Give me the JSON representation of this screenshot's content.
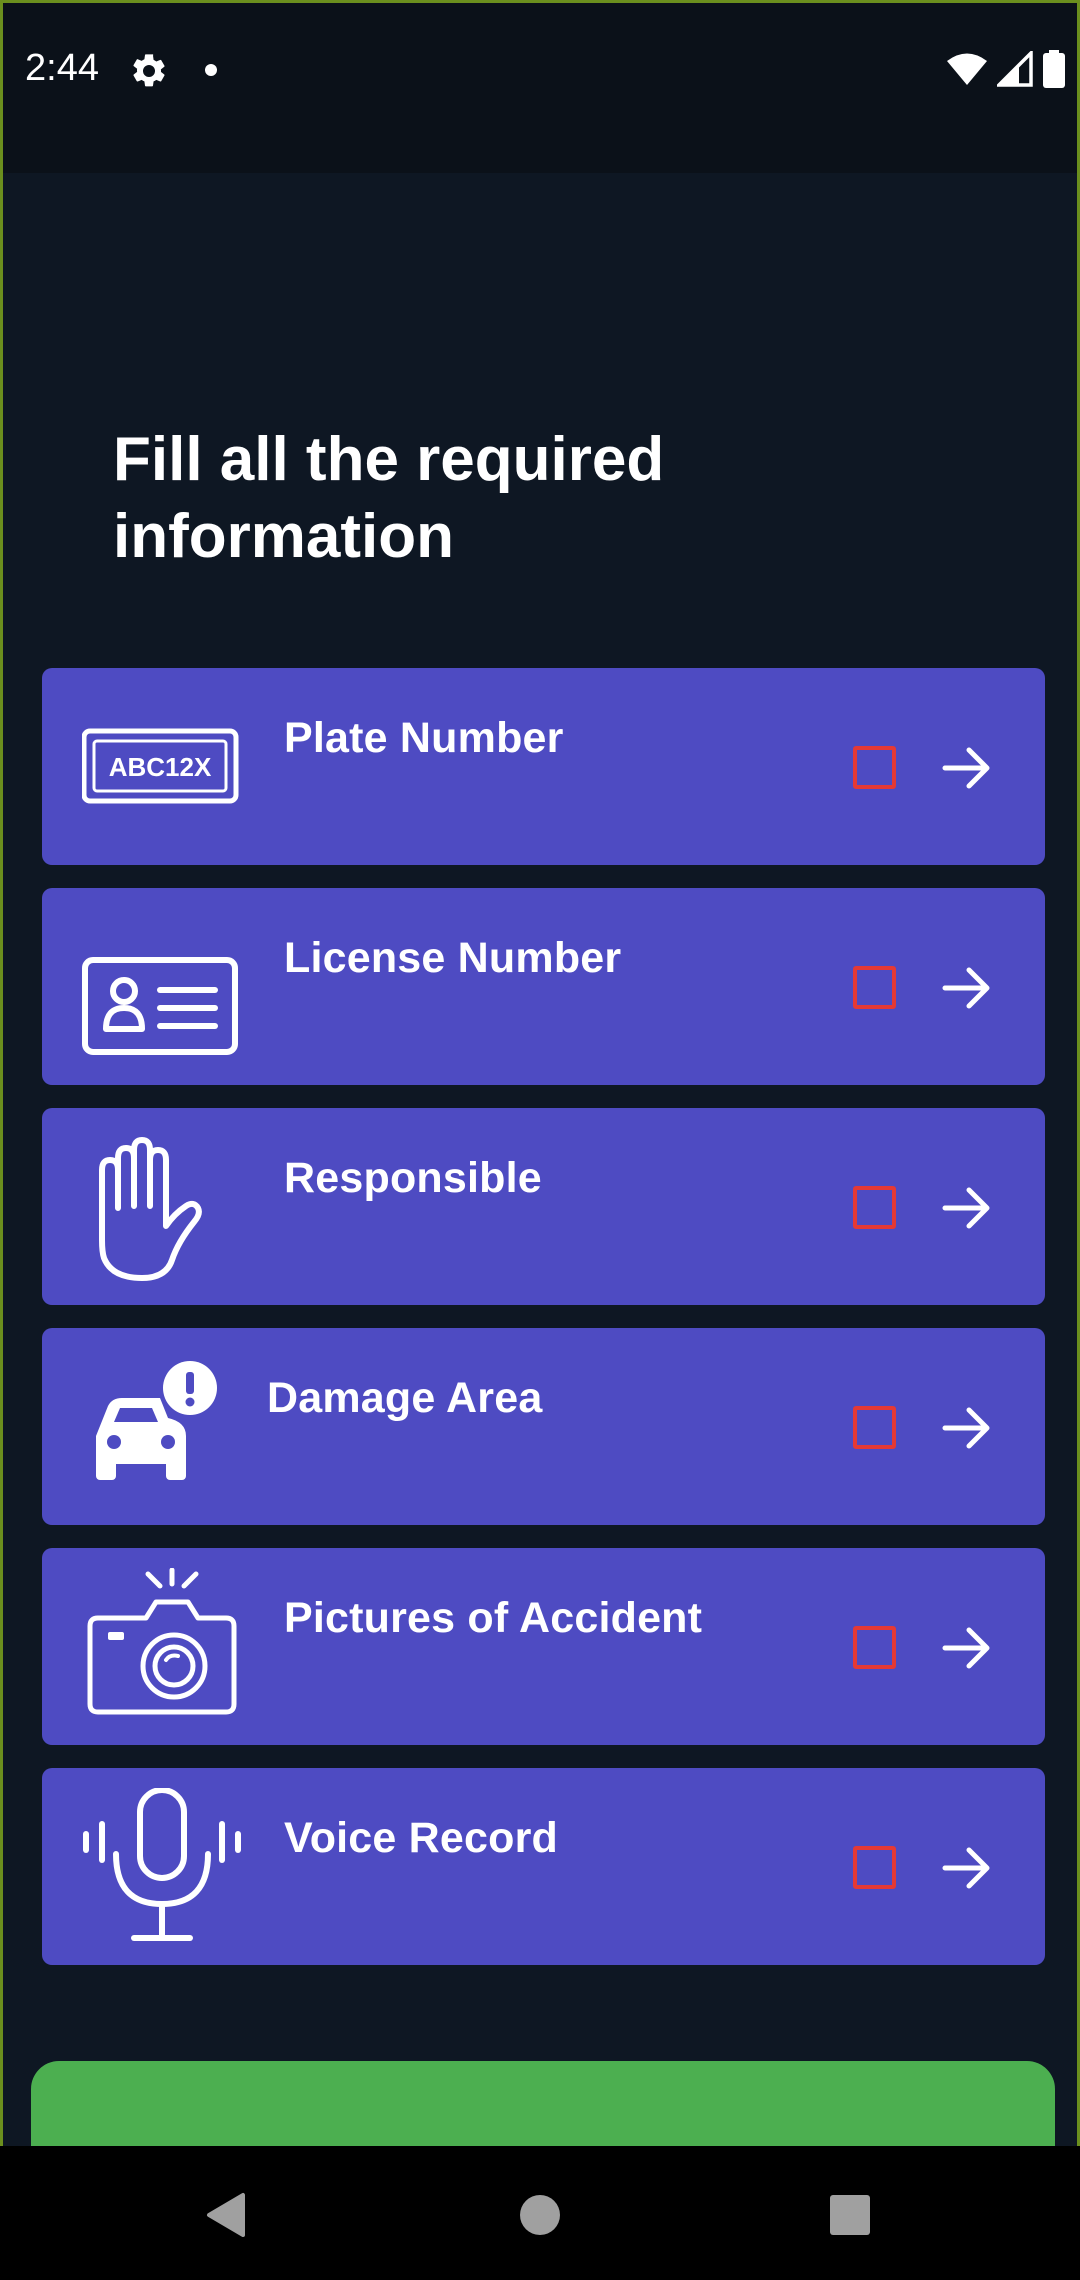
{
  "status_bar": {
    "time": "2:44",
    "icons": [
      "gear-icon",
      "notification-dot",
      "wifi-icon",
      "signal-icon",
      "battery-icon"
    ]
  },
  "page": {
    "title": "Fill all the required information"
  },
  "items": [
    {
      "label": "Plate Number",
      "icon": "license-plate-icon",
      "checked": false
    },
    {
      "label": "License Number",
      "icon": "id-card-icon",
      "checked": false
    },
    {
      "label": "Responsible",
      "icon": "hand-icon",
      "checked": false
    },
    {
      "label": "Damage Area",
      "icon": "car-alert-icon",
      "checked": false
    },
    {
      "label": "Pictures of Accident",
      "icon": "camera-icon",
      "checked": false
    },
    {
      "label": "Voice Record",
      "icon": "microphone-icon",
      "checked": false
    }
  ],
  "plate_icon_text": "ABC12X",
  "submit_button": {
    "label": ""
  },
  "nav": [
    "back-icon",
    "home-icon",
    "recents-icon"
  ],
  "colors": {
    "background": "#0e1723",
    "card": "#4e4bc2",
    "checkbox": "#e53935",
    "submit": "#4caf50"
  }
}
